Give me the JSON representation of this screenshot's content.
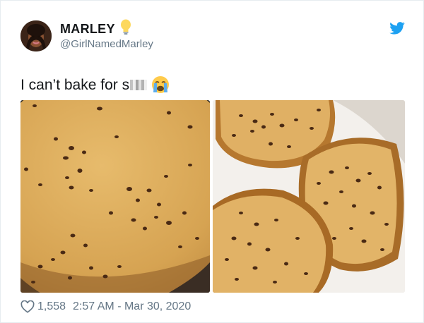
{
  "user": {
    "name": "MARLEY",
    "handle": "@GirlNamedMarley"
  },
  "tweet": {
    "text": "I can’t bake for s",
    "censored_part": "hit",
    "emoji": "loudly-crying-face"
  },
  "media": [
    {
      "description": "cookie-cake-in-pan"
    },
    {
      "description": "flat-chocolate-chip-cookies"
    }
  ],
  "footer": {
    "likes": "1,558",
    "timestamp": "2:57 AM - Mar 30, 2020"
  },
  "colors": {
    "twitter_blue": "#1da1f2",
    "text_primary": "#14171a",
    "text_secondary": "#657786"
  },
  "icons": [
    "lightbulb-icon",
    "twitter-bird-icon",
    "heart-icon",
    "crying-face-emoji"
  ]
}
